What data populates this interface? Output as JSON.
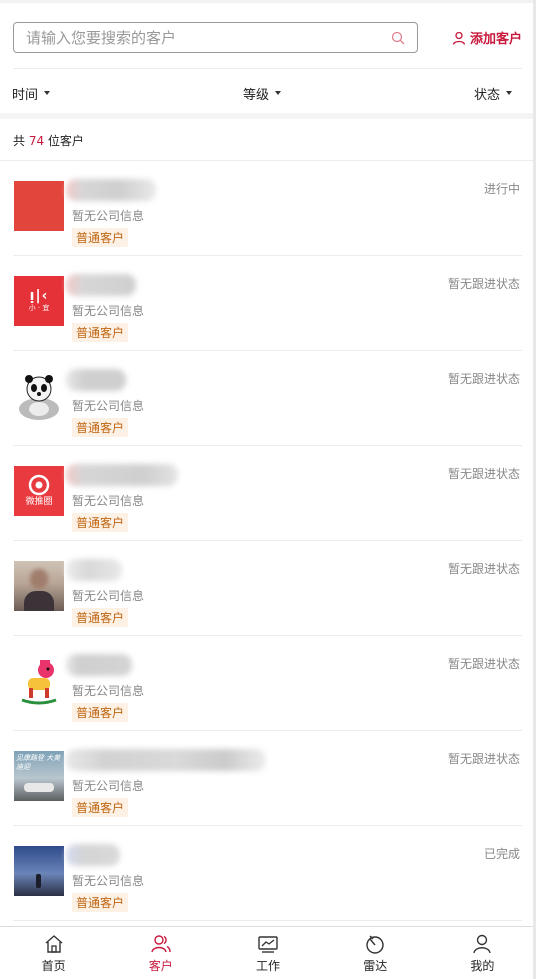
{
  "search": {
    "placeholder": "请输入您要搜索的客户",
    "add_label": "添加客户"
  },
  "filters": [
    {
      "label": "时间"
    },
    {
      "label": "等级"
    },
    {
      "label": "状态"
    }
  ],
  "count": {
    "prefix": "共 ",
    "number": "74",
    "suffix": " 位客户"
  },
  "customers": [
    {
      "company": "暂无公司信息",
      "level": "普通客户",
      "status": "进行中",
      "avatar": "red-square"
    },
    {
      "company": "暂无公司信息",
      "level": "普通客户",
      "status": "暂无跟进状态",
      "avatar": "xiaoyi-logo",
      "avatar_text": "小 · 宜"
    },
    {
      "company": "暂无公司信息",
      "level": "普通客户",
      "status": "暂无跟进状态",
      "avatar": "panda"
    },
    {
      "company": "暂无公司信息",
      "level": "普通客户",
      "status": "暂无跟进状态",
      "avatar": "weituiquan-logo",
      "avatar_text": "微推圈"
    },
    {
      "company": "暂无公司信息",
      "level": "普通客户",
      "status": "暂无跟进状态",
      "avatar": "photo-person"
    },
    {
      "company": "暂无公司信息",
      "level": "普通客户",
      "status": "暂无跟进状态",
      "avatar": "rocking-horse"
    },
    {
      "company": "暂无公司信息",
      "level": "普通客户",
      "status": "暂无跟进状态",
      "avatar": "car-poster",
      "avatar_text": "见康路登 大美迪迎"
    },
    {
      "company": "暂无公司信息",
      "level": "普通客户",
      "status": "已完成",
      "avatar": "night-sky"
    }
  ],
  "tabs": [
    {
      "label": "首页",
      "icon": "home-icon"
    },
    {
      "label": "客户",
      "icon": "customers-icon",
      "active": true
    },
    {
      "label": "工作",
      "icon": "work-icon"
    },
    {
      "label": "雷达",
      "icon": "radar-icon"
    },
    {
      "label": "我的",
      "icon": "profile-icon"
    }
  ],
  "colors": {
    "accent": "#c8193c",
    "tag_text": "#c06510",
    "tag_bg": "#fdf1e6"
  }
}
